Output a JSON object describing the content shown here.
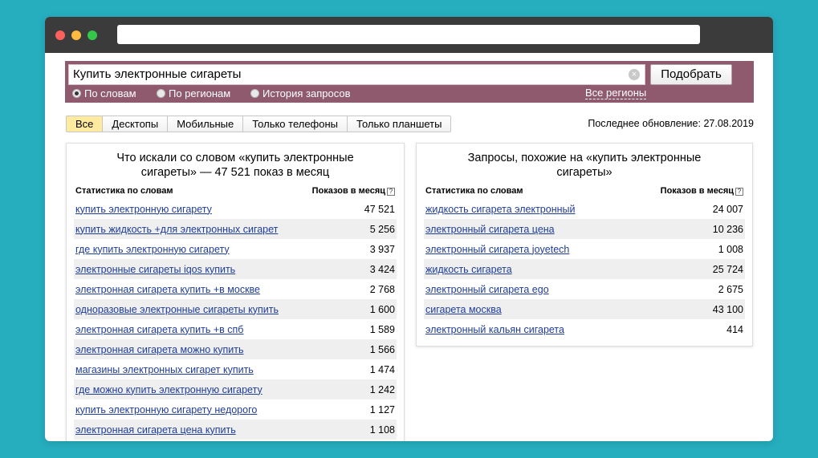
{
  "search": {
    "query": "Купить электронные сигареты",
    "clear_icon": "×",
    "submit_label": "Подобрать",
    "radios": [
      {
        "label": "По словам",
        "checked": true
      },
      {
        "label": "По регионам",
        "checked": false
      },
      {
        "label": "История запросов",
        "checked": false
      }
    ],
    "regions_link": "Все регионы"
  },
  "device_tabs": [
    {
      "label": "Все",
      "active": true
    },
    {
      "label": "Десктопы",
      "active": false
    },
    {
      "label": "Мобильные",
      "active": false
    },
    {
      "label": "Только телефоны",
      "active": false
    },
    {
      "label": "Только планшеты",
      "active": false
    }
  ],
  "last_update": "Последнее обновление: 27.08.2019",
  "left_panel": {
    "title_line1": "Что искали со словом «купить электронные",
    "title_line2": "сигареты» — 47 521 показ в месяц",
    "col_phrase": "Статистика по словам",
    "col_count": "Показов в месяц",
    "help_icon": "?",
    "rows": [
      {
        "phrase": "купить электронную сигарету",
        "count": "47 521"
      },
      {
        "phrase": "купить жидкость +для электронных сигарет",
        "count": "5 256"
      },
      {
        "phrase": "где купить электронную сигарету",
        "count": "3 937"
      },
      {
        "phrase": "электронные сигареты iqos купить",
        "count": "3 424"
      },
      {
        "phrase": "электронная сигарета купить +в москве",
        "count": "2 768"
      },
      {
        "phrase": "одноразовые электронные сигареты купить",
        "count": "1 600"
      },
      {
        "phrase": "электронная сигарета купить +в спб",
        "count": "1 589"
      },
      {
        "phrase": "электронная сигарета можно купить",
        "count": "1 566"
      },
      {
        "phrase": "магазины электронных сигарет купить",
        "count": "1 474"
      },
      {
        "phrase": "где можно купить электронную сигарету",
        "count": "1 242"
      },
      {
        "phrase": "купить электронную сигарету недорого",
        "count": "1 127"
      },
      {
        "phrase": "электронная сигарета цена купить",
        "count": "1 108"
      }
    ]
  },
  "right_panel": {
    "title_line1": "Запросы, похожие на «купить электронные",
    "title_line2": "сигареты»",
    "col_phrase": "Статистика по словам",
    "col_count": "Показов в месяц",
    "help_icon": "?",
    "rows": [
      {
        "phrase": "жидкость сигарета электронный",
        "count": "24 007"
      },
      {
        "phrase": "электронный сигарета цена",
        "count": "10 236"
      },
      {
        "phrase": "электронный сигарета joyetech",
        "count": "1 008"
      },
      {
        "phrase": "жидкость сигарета",
        "count": "25 724"
      },
      {
        "phrase": "электронный сигарета ego",
        "count": "2 675"
      },
      {
        "phrase": "сигарета москва",
        "count": "43 100"
      },
      {
        "phrase": "электронный кальян сигарета",
        "count": "414"
      }
    ]
  }
}
